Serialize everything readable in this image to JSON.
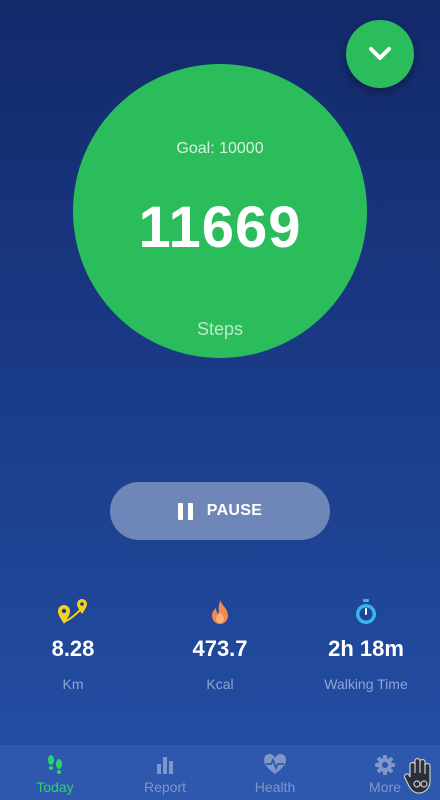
{
  "header": {
    "collapse_icon": "chevron-down-icon"
  },
  "counter": {
    "goal_text": "Goal: 10000",
    "steps": "11669",
    "steps_label": "Steps"
  },
  "controls": {
    "pause_label": "PAUSE",
    "pause_icon": "pause-icon"
  },
  "stats": [
    {
      "icon": "route-icon",
      "value": "8.28",
      "unit": "Km"
    },
    {
      "icon": "flame-icon",
      "value": "473.7",
      "unit": "Kcal"
    },
    {
      "icon": "stopwatch-icon",
      "value": "2h 18m",
      "unit": "Walking Time"
    }
  ],
  "nav": {
    "items": [
      {
        "label": "Today",
        "icon": "footprints-icon",
        "active": true
      },
      {
        "label": "Report",
        "icon": "bar-chart-icon",
        "active": false
      },
      {
        "label": "Health",
        "icon": "heart-pulse-icon",
        "active": false
      },
      {
        "label": "More",
        "icon": "gear-icon",
        "active": false
      }
    ]
  },
  "colors": {
    "accent_green": "#2bbd5c",
    "active_green": "#2bd46a",
    "route_yellow": "#f5d21e",
    "flame_orange": "#f08a4b",
    "stopwatch_blue": "#35b6f0",
    "inactive_nav": "#7f96c8"
  }
}
